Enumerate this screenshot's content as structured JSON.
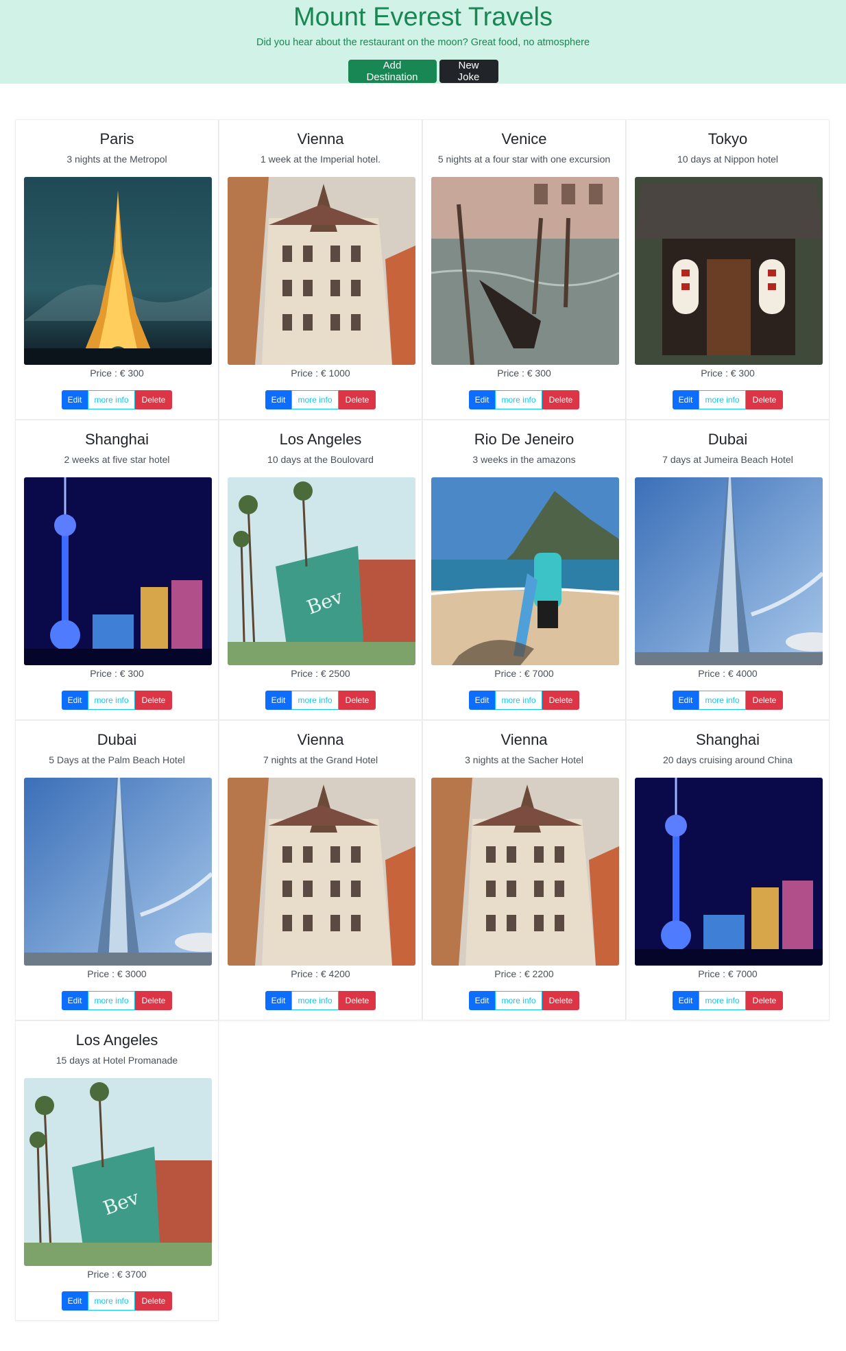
{
  "header": {
    "title": "Mount Everest Travels",
    "joke": "Did you hear about the restaurant on the moon? Great food, no atmosphere",
    "add_button": "Add Destination",
    "joke_button": "New Joke"
  },
  "card_buttons": {
    "edit": "Edit",
    "info": "more info",
    "delete": "Delete"
  },
  "destinations": [
    {
      "title": "Paris",
      "desc": "3 nights at the Metropol",
      "price": "Price : € 300",
      "image": "eiffel-tower-image"
    },
    {
      "title": "Vienna",
      "desc": "1 week at the Imperial hotel.",
      "price": "Price : € 1000",
      "image": "vienna-building-image"
    },
    {
      "title": "Venice",
      "desc": "5 nights at a four star with one excursion",
      "price": "Price : € 300",
      "image": "venice-gondola-image"
    },
    {
      "title": "Tokyo",
      "desc": "10 days at Nippon hotel",
      "price": "Price : € 300",
      "image": "tokyo-shrine-image"
    },
    {
      "title": "Shanghai",
      "desc": "2 weeks at five star hotel",
      "price": "Price : € 300",
      "image": "shanghai-tower-image"
    },
    {
      "title": "Los Angeles",
      "desc": "10 days at the Boulovard",
      "price": "Price : € 2500",
      "image": "beverly-hills-image"
    },
    {
      "title": "Rio De Jeneiro",
      "desc": "3 weeks in the amazons",
      "price": "Price : € 7000",
      "image": "rio-beach-image"
    },
    {
      "title": "Dubai",
      "desc": "7 days at Jumeira Beach Hotel",
      "price": "Price : € 4000",
      "image": "burj-khalifa-image"
    },
    {
      "title": "Dubai",
      "desc": "5 Days at the Palm Beach Hotel",
      "price": "Price : € 3000",
      "image": "burj-khalifa-image"
    },
    {
      "title": "Vienna",
      "desc": "7 nights at the Grand Hotel",
      "price": "Price : € 4200",
      "image": "vienna-building-image"
    },
    {
      "title": "Vienna",
      "desc": "3 nights at the Sacher Hotel",
      "price": "Price : € 2200",
      "image": "vienna-building-image"
    },
    {
      "title": "Shanghai",
      "desc": "20 days cruising around China",
      "price": "Price : € 7000",
      "image": "shanghai-tower-image"
    },
    {
      "title": "Los Angeles",
      "desc": "15 days at Hotel Promanade",
      "price": "Price : € 3700",
      "image": "beverly-hills-image"
    }
  ],
  "colors": {
    "header_bg": "#d1f2e6",
    "brand_green": "#198754",
    "primary": "#0d6efd",
    "info": "#0dcaf0",
    "danger": "#dc3545",
    "dark": "#212529"
  }
}
